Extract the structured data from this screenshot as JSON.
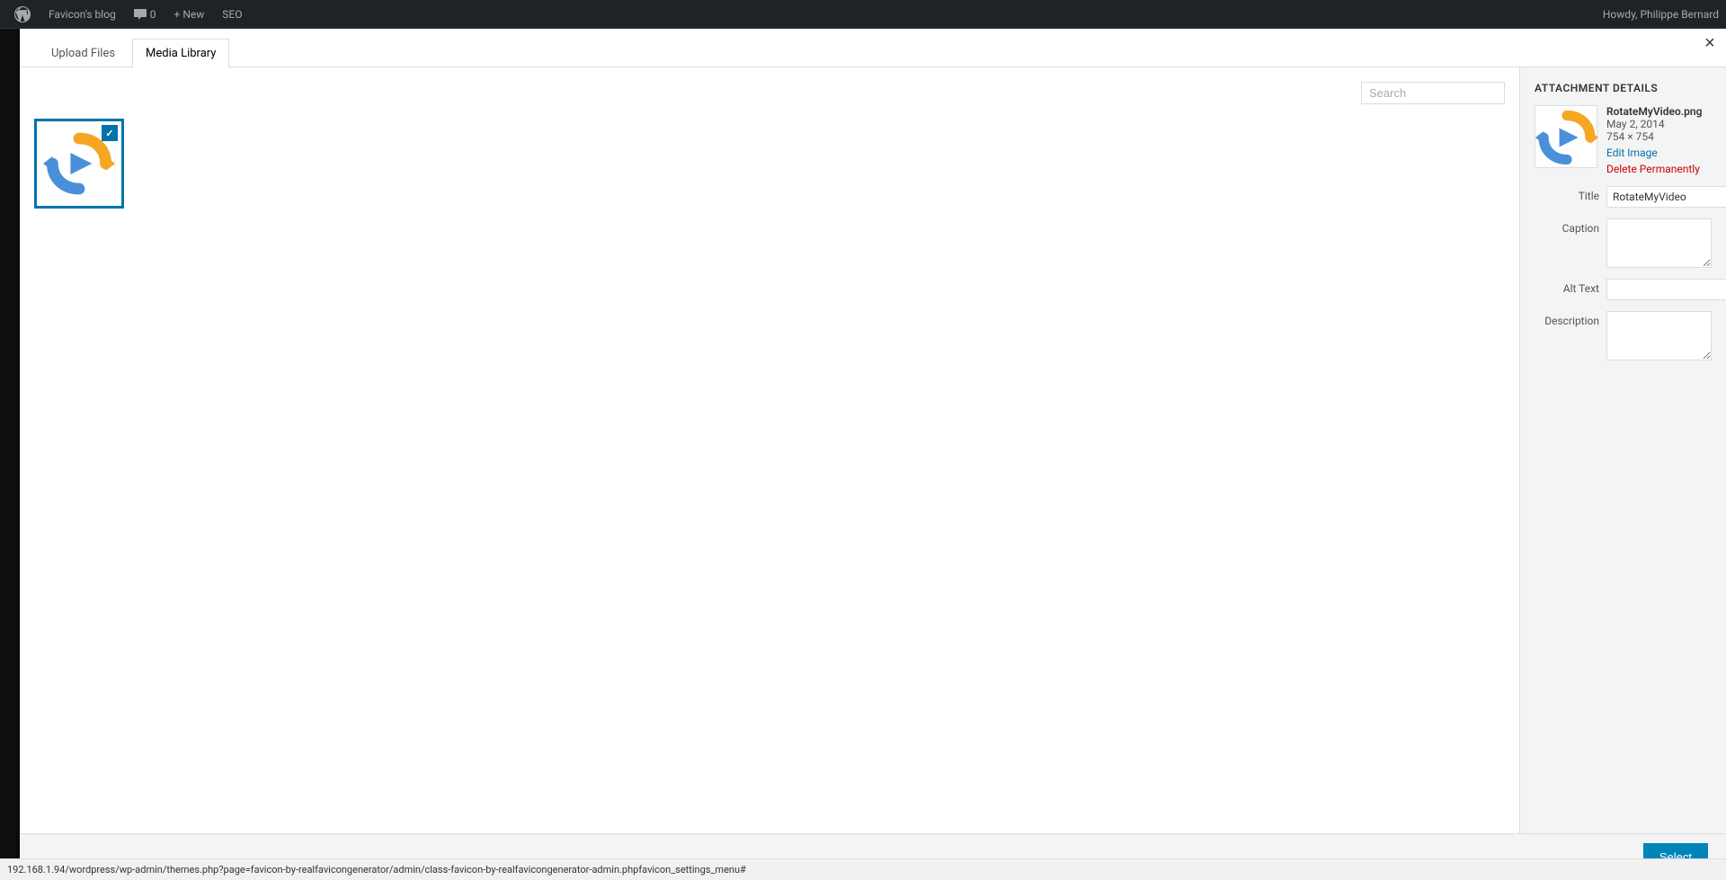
{
  "adminBar": {
    "logo": "wordpress-icon",
    "items": [
      {
        "label": "Favicon's blog",
        "icon": "house-icon"
      },
      {
        "label": "0",
        "icon": "comment-icon"
      },
      {
        "label": "+ New",
        "icon": ""
      },
      {
        "label": "SEO",
        "icon": ""
      }
    ],
    "userGreeting": "Howdy, Philippe Bernard"
  },
  "modal": {
    "closeLabel": "×",
    "tabs": [
      {
        "label": "Upload Files",
        "active": false
      },
      {
        "label": "Media Library",
        "active": true
      }
    ],
    "toolbar": {
      "searchPlaceholder": "Search"
    },
    "attachmentDetails": {
      "sectionTitle": "ATTACHMENT DETAILS",
      "filename": "RotateMyVideo.png",
      "date": "May 2, 2014",
      "dimensions": "754 × 754",
      "editImageLabel": "Edit Image",
      "deleteLabel": "Delete Permanently",
      "fields": [
        {
          "label": "Title",
          "value": "RotateMyVideo",
          "type": "input"
        },
        {
          "label": "Caption",
          "value": "",
          "type": "textarea"
        },
        {
          "label": "Alt Text",
          "value": "",
          "type": "input"
        },
        {
          "label": "Description",
          "value": "",
          "type": "textarea"
        }
      ]
    },
    "footer": {
      "selectLabel": "Select"
    }
  },
  "statusBar": {
    "url": "192.168.1.94/wordpress/wp-admin/themes.php?page=favicon-by-realfavicongenerator/admin/class-favicon-by-realfavicongenerator-admin.phpfavicon_settings_menu#"
  }
}
